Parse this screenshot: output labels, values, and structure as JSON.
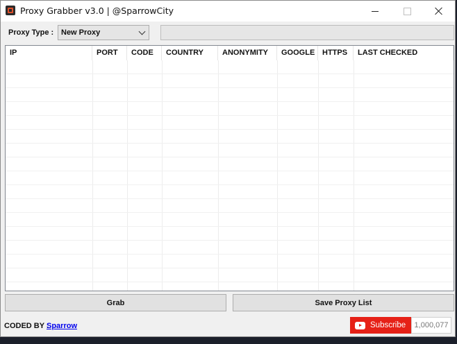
{
  "window": {
    "title": "Proxy Grabber v3.0 | @SparrowCity"
  },
  "controls": {
    "proxy_type_label": "Proxy Type :",
    "proxy_type_value": "New Proxy",
    "progress": 0
  },
  "table": {
    "columns": [
      "IP",
      "PORT",
      "CODE",
      "COUNTRY",
      "ANONYMITY",
      "GOOGLE",
      "HTTPS",
      "LAST CHECKED"
    ],
    "rows": []
  },
  "buttons": {
    "grab": "Grab",
    "save": "Save Proxy List"
  },
  "footer": {
    "coded_by_label": "CODED BY :",
    "coded_by_link": "Sparrow",
    "subscribe_label": "Subscribe",
    "subscriber_count": "1,000,077"
  },
  "colors": {
    "subscribe_red": "#e62117",
    "link_blue": "#0000ee"
  },
  "icons": {
    "app": "app-icon",
    "subscribe": "youtube-icon"
  }
}
